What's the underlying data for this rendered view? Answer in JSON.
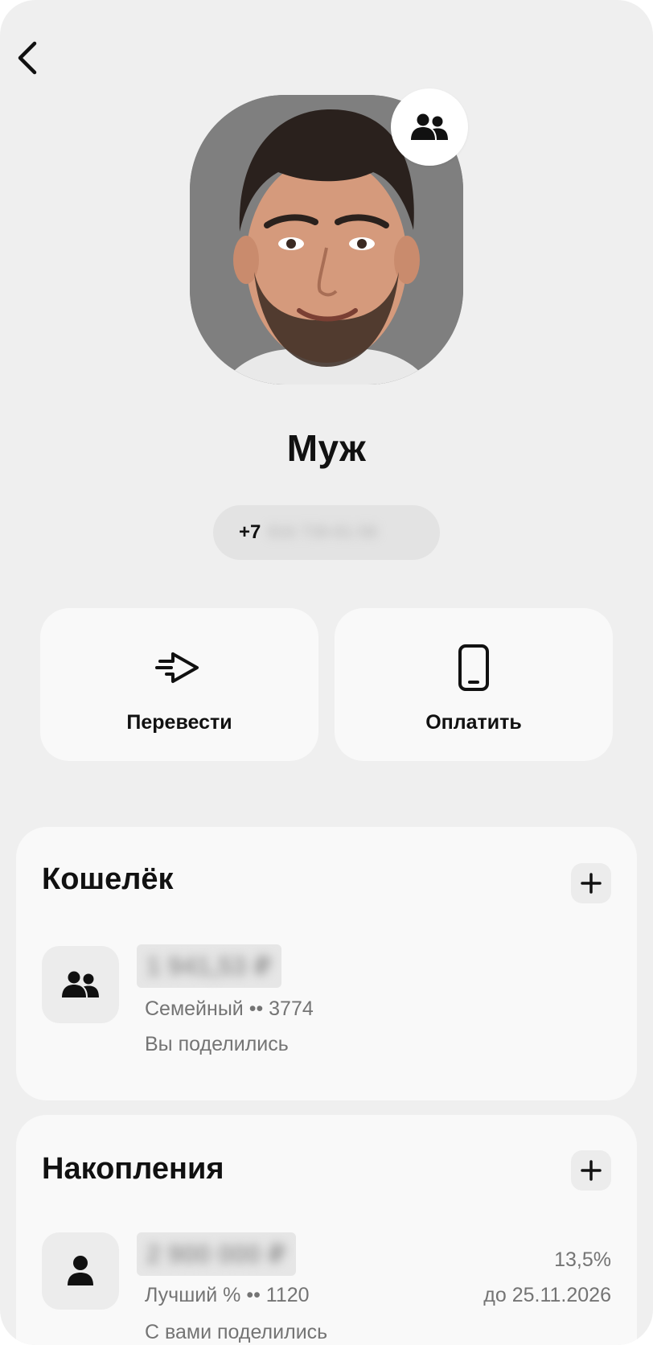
{
  "header": {
    "back_icon": "chevron-left-icon"
  },
  "contact": {
    "name": "Муж",
    "badge_icon": "users-icon",
    "phone_prefix": "+7",
    "phone_masked": "916 739-81-58"
  },
  "actions": [
    {
      "label": "Перевести",
      "icon": "transfer-arrow-icon"
    },
    {
      "label": "Оплатить",
      "icon": "smartphone-icon"
    }
  ],
  "wallet": {
    "title": "Кошелёк",
    "add_icon": "plus-icon",
    "item": {
      "icon": "users-icon",
      "amount_masked": "1 941,53 ₽",
      "name": "Семейный •• 3774",
      "status": "Вы поделились"
    }
  },
  "savings": {
    "title": "Накопления",
    "add_icon": "plus-icon",
    "item": {
      "icon": "user-icon",
      "amount_masked": "2 900 000 ₽",
      "name": "Лучший % •• 1120",
      "status": "С вами поделились",
      "rate": "13,5%",
      "until": "до 25.11.2026"
    }
  },
  "colors": {
    "background": "#efefef",
    "card": "#f9f9f9",
    "pill": "#e3e3e3",
    "icon_tile": "#ececec",
    "muted_text": "#747474",
    "text": "#111111"
  }
}
